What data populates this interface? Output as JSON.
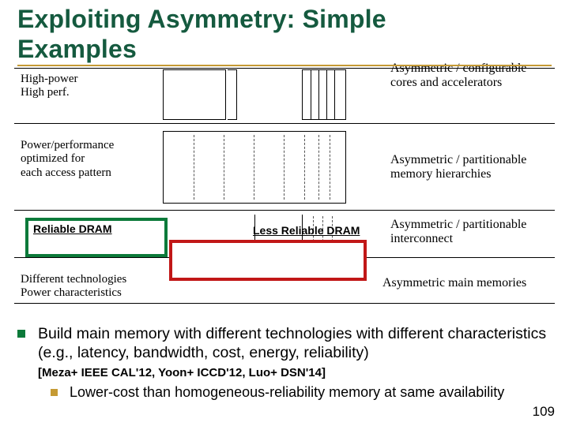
{
  "title_line1": "Exploiting Asymmetry: Simple",
  "title_line2": "Examples",
  "left_labels": {
    "r1": "High-power\nHigh perf.",
    "r2": "Power/performance\noptimized for\neach access pattern",
    "r3": "",
    "r4": "Different technologies\nPower characteristics"
  },
  "right_labels": {
    "r1": "Asymmetric / configurable\ncores and accelerators",
    "r2": "Asymmetric / partitionable\nmemory hierarchies",
    "r3": "Asymmetric / partitionable\ninterconnect",
    "r4": "Asymmetric main memories"
  },
  "dram": {
    "reliable": "Reliable DRAM",
    "less": "Less Reliable DRAM"
  },
  "bullet_main": "Build main memory with different technologies with different characteristics (e.g., latency, bandwidth, cost, energy, reliability)",
  "citation": "[Meza+ IEEE CAL'12, Yoon+ ICCD'12, Luo+ DSN'14]",
  "sub_bullet": "Lower-cost than homogeneous-reliability memory at same availability",
  "slide_number": "109"
}
